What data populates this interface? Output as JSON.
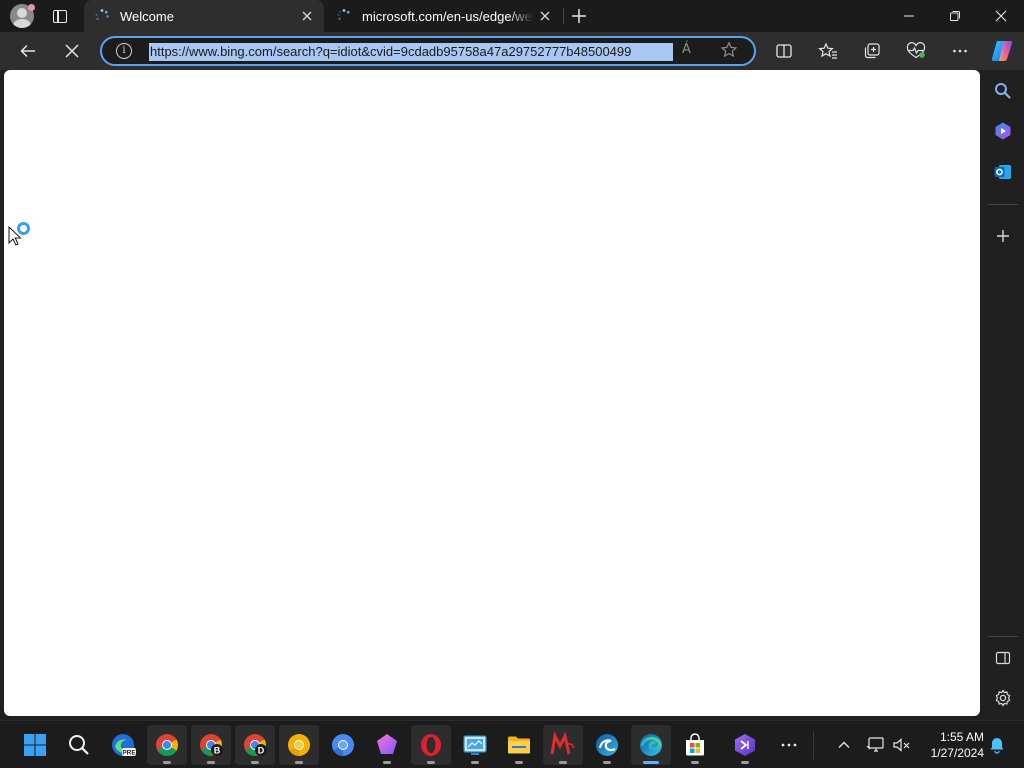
{
  "tabs": [
    {
      "title": "Welcome",
      "loading": true,
      "active": true
    },
    {
      "title": "microsoft.com/en-us/edge/welcome",
      "loading": true,
      "active": false
    }
  ],
  "address_bar": {
    "url": "https://www.bing.com/search?q=idiot&cvid=9cdadb95758a47a29752777b48500499",
    "selected": true,
    "read_aloud_glyph": "Á"
  },
  "toolbar": {
    "back_icon": "back-arrow-icon",
    "stop_icon": "stop-loading-icon",
    "buttons": [
      "split-screen-icon",
      "favorites-icon",
      "collections-icon",
      "browser-essentials-icon",
      "more-options-icon",
      "copilot-icon"
    ]
  },
  "sidebar": {
    "buttons": [
      "search-icon",
      "copilot-sidebar-icon",
      "outlook-icon",
      "add-icon",
      "hide-sidebar-icon",
      "settings-icon"
    ]
  },
  "taskbar": {
    "apps": [
      {
        "name": "start-button",
        "open": false
      },
      {
        "name": "search-button",
        "open": false
      },
      {
        "name": "edge-beta-app",
        "open": false,
        "badge": "PRE"
      },
      {
        "name": "chrome-app",
        "open": true,
        "running": true
      },
      {
        "name": "chrome-beta-app",
        "open": true,
        "running": true,
        "badge": "B"
      },
      {
        "name": "chrome-dev-app",
        "open": true,
        "running": true,
        "badge": "D"
      },
      {
        "name": "chrome-canary-app",
        "open": true,
        "running": true
      },
      {
        "name": "chromium-app",
        "open": false
      },
      {
        "name": "gem-app",
        "open": false,
        "running": true
      },
      {
        "name": "opera-app",
        "open": true,
        "running": true
      },
      {
        "name": "control-panel-app",
        "open": false,
        "running": true
      },
      {
        "name": "file-explorer-app",
        "open": false,
        "running": true
      },
      {
        "name": "maxthon-app",
        "open": true,
        "running": true
      },
      {
        "name": "edge-dev-app",
        "open": false,
        "running": true
      },
      {
        "name": "edge-app",
        "open": true,
        "running": true,
        "active": true
      },
      {
        "name": "microsoft-store-app",
        "open": false,
        "running": true
      },
      {
        "name": "visual-studio-app",
        "open": false,
        "running": true
      },
      {
        "name": "more-apps-button",
        "open": false
      }
    ],
    "tray": [
      "show-hidden-icons",
      "network-icon",
      "volume-muted-icon",
      "notifications-icon"
    ],
    "time": "1:55 AM",
    "date": "1/27/2024"
  },
  "colors": {
    "accent": "#5aa3f0",
    "selection": "#a6c8f2",
    "loading_ring": "#3aa0e8"
  }
}
